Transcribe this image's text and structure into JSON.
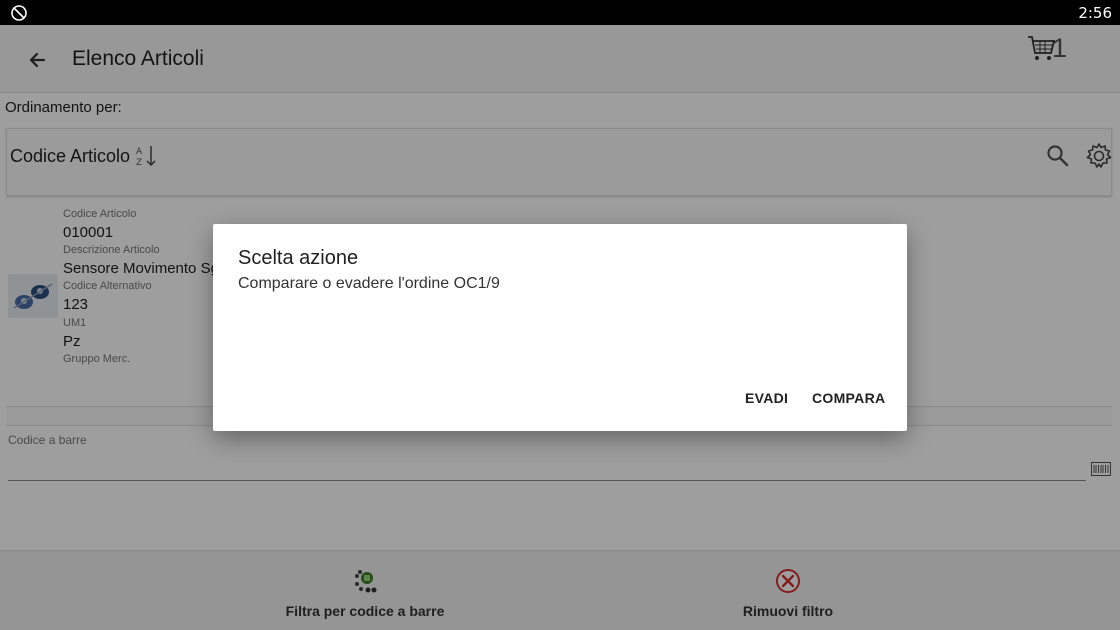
{
  "statusbar": {
    "time": "2:56",
    "rotate_icon": "screen-rotation-icon"
  },
  "appbar": {
    "title": "Elenco Articoli",
    "cart_count": "1",
    "back_icon": "back-arrow-icon",
    "cart_icon": "shopping-cart-icon"
  },
  "sort": {
    "label": "Ordinamento per:",
    "field": "Codice Articolo",
    "sort_icon": "sort-az-icon",
    "search_icon": "search-icon",
    "settings_icon": "gear-icon"
  },
  "item": {
    "code_label": "Codice Articolo",
    "code": "010001",
    "desc_label": "Descrizione Articolo",
    "desc": "Sensore Movimento Sg",
    "alt_label": "Codice Alternativo",
    "alt": "123",
    "um_label": "UM1",
    "um": "Pz",
    "group_label": "Gruppo Merc."
  },
  "barcode": {
    "label": "Codice a barre",
    "value": "",
    "icon": "barcode-icon"
  },
  "bottom": {
    "filter_label": "Filtra per codice a barre",
    "remove_label": "Rimuovi filtro"
  },
  "dialog": {
    "title": "Scelta azione",
    "message": "Comparare o evadere l'ordine OC1/9",
    "evadi": "EVADI",
    "compara": "COMPARA"
  },
  "colors": {
    "statusbar": "#000000",
    "scrim": "rgba(0,0,0,0.38)",
    "remove_icon": "#d32f2f",
    "filter_icon": "#3a7d2a"
  }
}
